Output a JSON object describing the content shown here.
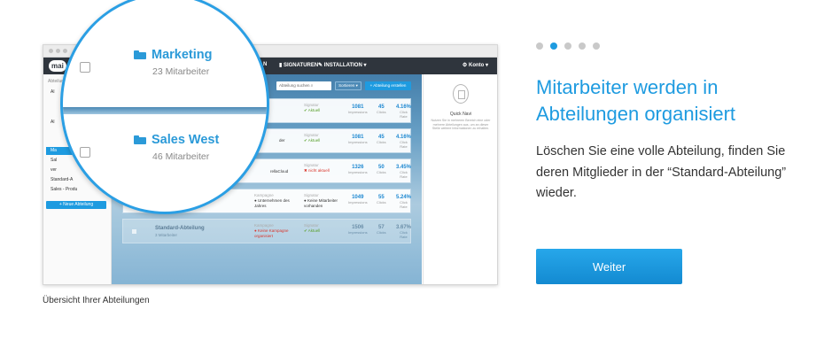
{
  "screenshot": {
    "topnav": {
      "logo": "mai",
      "item_partial": "N",
      "signaturen": "SIGNATUREN",
      "installation": "INSTALLATION",
      "konto": "Konto"
    },
    "sidebar": {
      "title": "Abteilung",
      "items": [
        "Al",
        "Al",
        "Ma",
        "Sal",
        "ver",
        "Standard-A",
        "Sales - Produ"
      ],
      "add_button": "+ Neue Abteilung"
    },
    "toolbar": {
      "search_placeholder": "Abteilung suchen",
      "sort_label": "Sortieren",
      "add_label": "+ Abteilung erstellen"
    },
    "rows": [
      {
        "campaign_label": "",
        "campaign": "",
        "signature_label": "Signatur",
        "signature": "Aktuell",
        "signature_status": "ok",
        "impressions": "1081",
        "impressions_label": "Impressions",
        "clicks": "45",
        "clicks_label": "Clicks",
        "rate": "4.16%",
        "rate_label": "Click Rate"
      },
      {
        "campaign_label": "",
        "campaign": "der",
        "signature_label": "Signatur",
        "signature": "Aktuell",
        "signature_status": "ok",
        "impressions": "1081",
        "impressions_label": "Impressions",
        "clicks": "45",
        "clicks_label": "Clicks",
        "rate": "4.16%",
        "rate_label": "Click Rate"
      },
      {
        "campaign_label": "",
        "campaign": "rellaCloud",
        "signature_label": "Signatur",
        "signature": "nicht aktuell",
        "signature_status": "error",
        "impressions": "1326",
        "impressions_label": "Impressions",
        "clicks": "50",
        "clicks_label": "Clicks",
        "rate": "3.45%",
        "rate_label": "Click Rate"
      },
      {
        "campaign_label": "Kampagne",
        "campaign": "Unternehmen des Jahres",
        "signature_label": "Signatur",
        "signature": "Keine Mitarbeiter vorhanden",
        "signature_status": "none",
        "impressions": "1049",
        "impressions_label": "Impressions",
        "clicks": "55",
        "clicks_label": "Clicks",
        "rate": "5.24%",
        "rate_label": "Click Rate"
      },
      {
        "name": "Standard-Abteilung",
        "sub": "3 Mitarbeiter",
        "campaign_label": "Kampagne",
        "campaign": "Keine Kampagne organisiert",
        "signature_label": "Signatur",
        "signature": "Aktuell",
        "signature_status": "ok",
        "impressions": "1506",
        "impressions_label": "Impressions",
        "clicks": "57",
        "clicks_label": "Clicks",
        "rate": "3.67%",
        "rate_label": "Click Rate"
      }
    ],
    "quick_navi": {
      "title": "Quick Navi",
      "text": "Nutzen Sie in mehreren Bereich eine oder mehrere Abteilungen aus, um an dieser Stelle weitere Informationen zu erhalten."
    },
    "magnifier": {
      "items": [
        {
          "name": "Marketing",
          "count": "23 Mitarbeiter"
        },
        {
          "name": "Sales West",
          "count": "46 Mitarbeiter"
        }
      ]
    }
  },
  "caption": "Übersicht Ihrer Abteilungen",
  "pager": {
    "count": 5,
    "active_index": 1
  },
  "headline": "Mitarbeiter werden in Abteilungen organisiert",
  "body": "Löschen Sie eine volle Abteilung, finden Sie deren Mitglieder in der “Standard-Abteilung” wieder.",
  "button_label": "Weiter",
  "colors": {
    "accent": "#1e9be0",
    "navbar": "#2f353d",
    "ok": "#5aa02c",
    "error": "#d9352b"
  },
  "icons": [
    "folder-icon",
    "checkbox-icon",
    "quick-navi-icon",
    "pencil-icon",
    "gear-icon",
    "chevron-down-icon"
  ]
}
